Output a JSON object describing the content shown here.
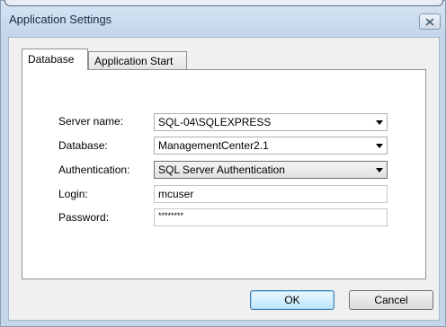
{
  "window": {
    "title": "Application Settings",
    "close_icon": "close-icon"
  },
  "tabs": [
    {
      "label": "Database",
      "active": true
    },
    {
      "label": "Application Start",
      "active": false
    }
  ],
  "form": {
    "server_name": {
      "label": "Server name:",
      "value": "SQL-04\\SQLEXPRESS"
    },
    "database": {
      "label": "Database:",
      "value": "ManagementCenter2.1"
    },
    "authentication": {
      "label": "Authentication:",
      "value": "SQL Server Authentication"
    },
    "login": {
      "label": "Login:",
      "value": "mcuser"
    },
    "password": {
      "label": "Password:",
      "value": "********"
    }
  },
  "buttons": {
    "ok": "OK",
    "cancel": "Cancel"
  }
}
